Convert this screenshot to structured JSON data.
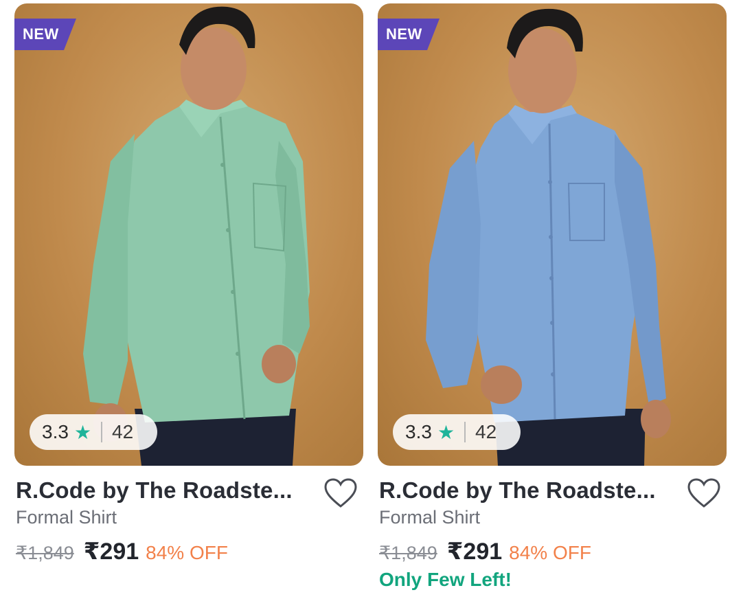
{
  "products": [
    {
      "badge": "NEW",
      "rating": "3.3",
      "rating_count": "42",
      "brand": "R.Code by The Roadste...",
      "type": "Formal Shirt",
      "mrp": "₹1,849",
      "price": "₹291",
      "discount": "84% OFF",
      "stock_note": "",
      "shirt_color": "#8ec8ab",
      "icons": {
        "rating": "star-icon",
        "wishlist": "heart-outline-icon"
      }
    },
    {
      "badge": "NEW",
      "rating": "3.3",
      "rating_count": "42",
      "brand": "R.Code by The Roadste...",
      "type": "Formal Shirt",
      "mrp": "₹1,849",
      "price": "₹291",
      "discount": "84% OFF",
      "stock_note": "Only Few Left!",
      "shirt_color": "#7fa6d6",
      "icons": {
        "rating": "star-icon",
        "wishlist": "heart-outline-icon"
      }
    }
  ],
  "colors": {
    "badge_bg": "#5c46b8",
    "star": "#1fb49a",
    "discount": "#f2814a",
    "stock_note": "#12a57e",
    "background": "#c6914f"
  }
}
